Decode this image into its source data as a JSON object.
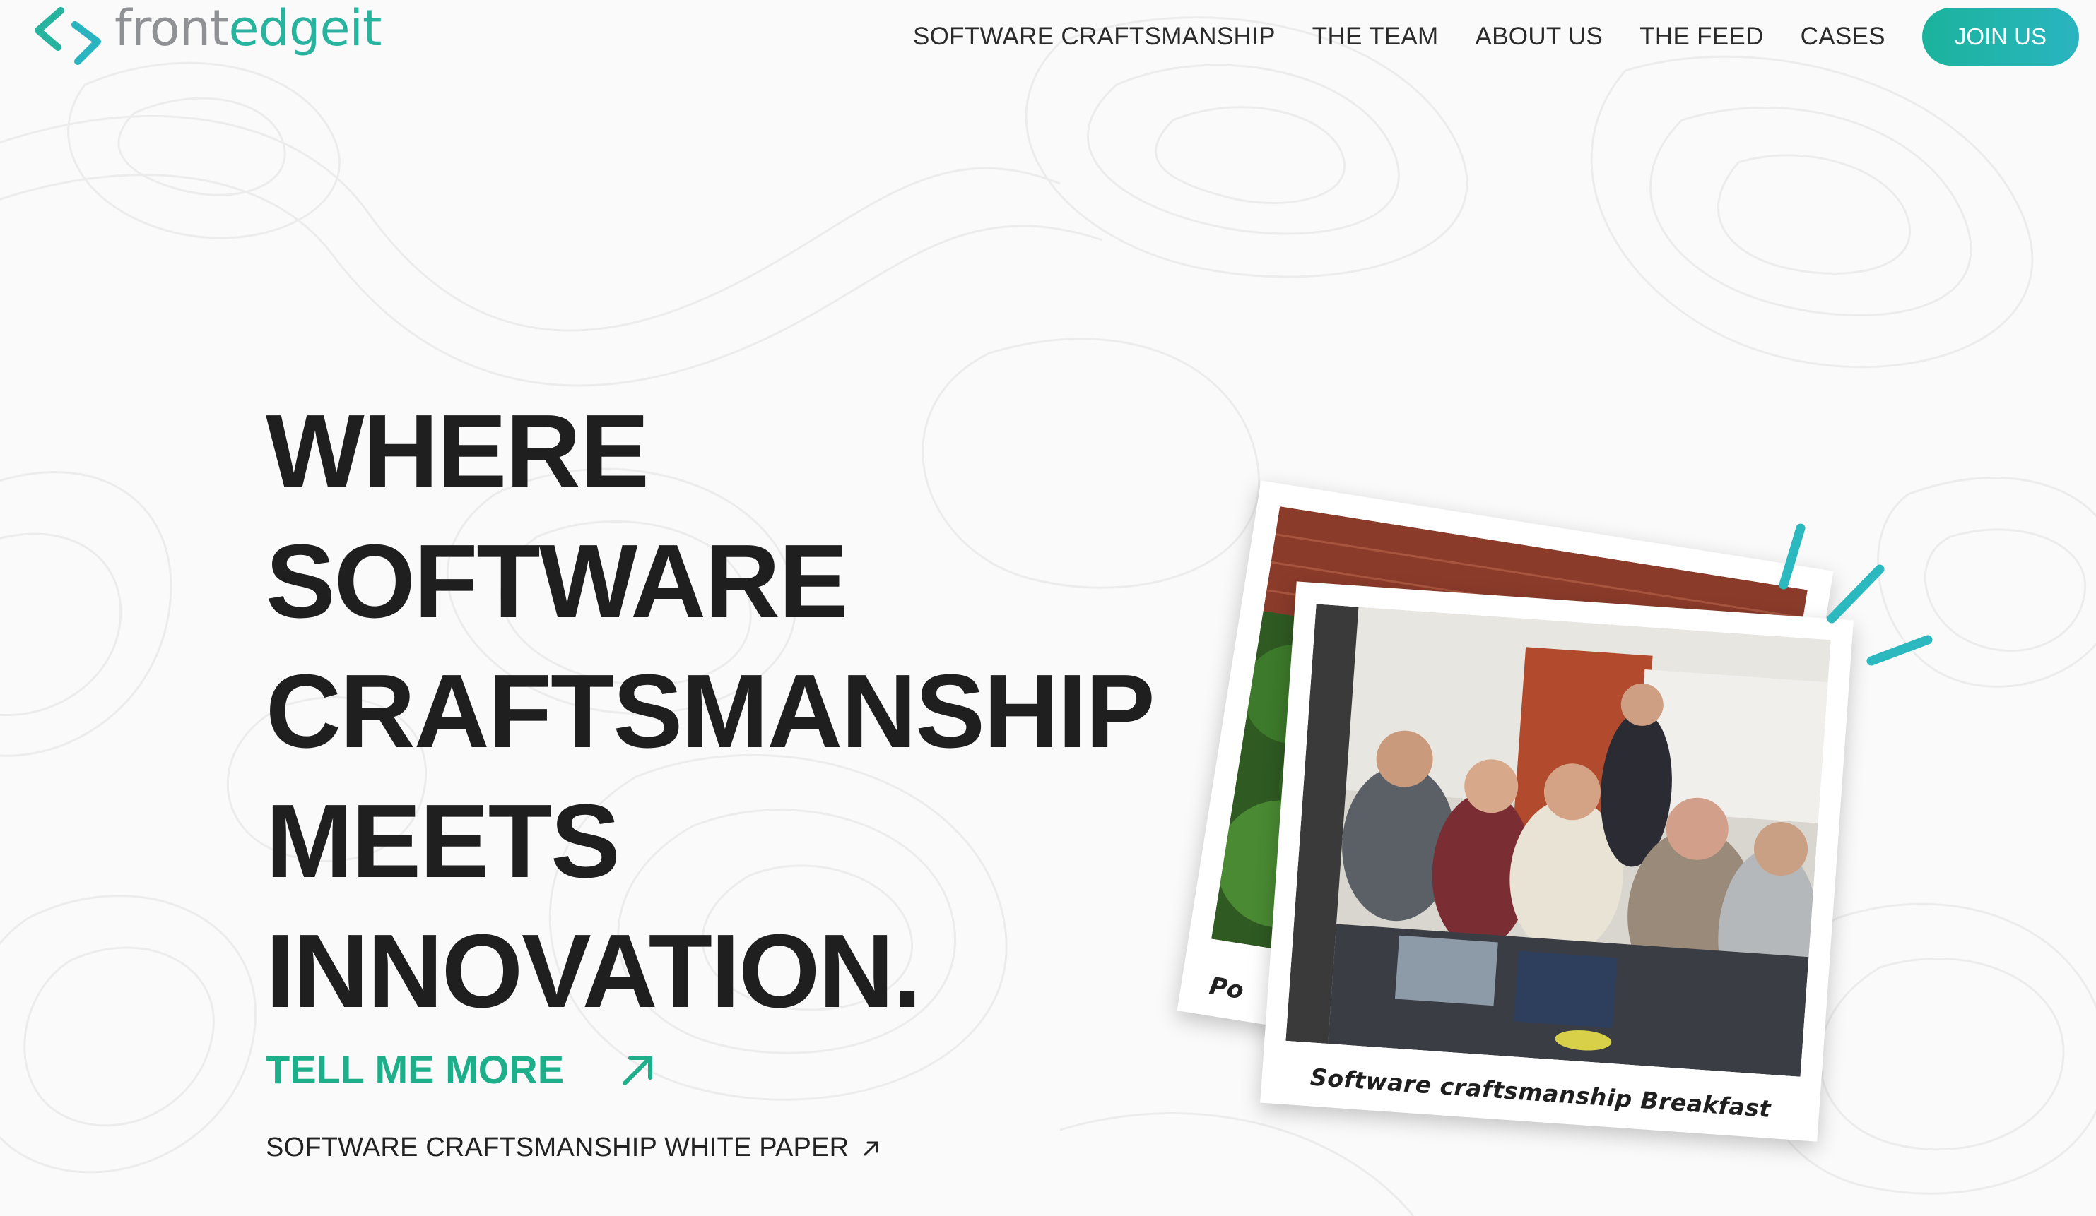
{
  "brand": {
    "name_part1": "front",
    "name_part2": "edgeit",
    "colors": {
      "accent": "#27b39e",
      "gray": "#8f9194",
      "cta": "#1fae8a"
    }
  },
  "nav": {
    "items": [
      {
        "label": "SOFTWARE CRAFTSMANSHIP"
      },
      {
        "label": "THE TEAM"
      },
      {
        "label": "ABOUT US"
      },
      {
        "label": "THE FEED"
      },
      {
        "label": "CASES"
      }
    ],
    "join_label": "JOIN US"
  },
  "hero": {
    "headline_lines": [
      "WHERE",
      "SOFTWARE",
      "CRAFTSMANSHIP",
      "MEETS",
      "INNOVATION."
    ],
    "cta_label": "TELL ME MORE",
    "cta_icon": "arrow-up-right-icon",
    "secondary_label": "SOFTWARE CRAFTSMANSHIP WHITE PAPER",
    "secondary_icon": "arrow-up-right-icon"
  },
  "photos": {
    "back_caption": "Po",
    "front_caption": "Software craftsmanship Breakfast"
  }
}
